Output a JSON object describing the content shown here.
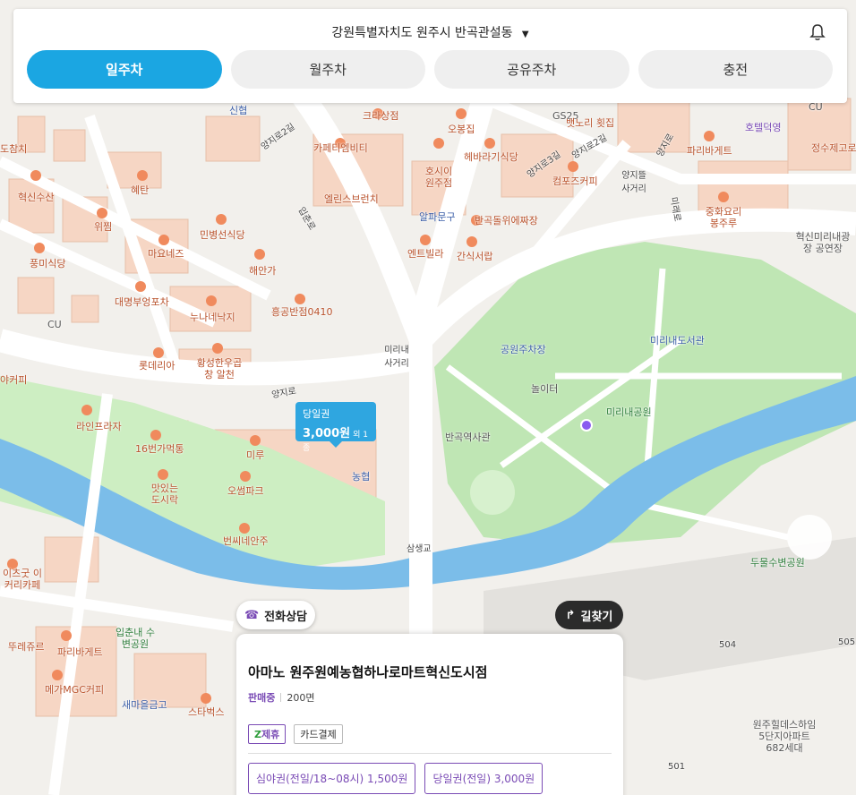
{
  "header": {
    "address": "강원특별자치도 원주시 반곡관설동",
    "tabs": [
      {
        "label": "일주차",
        "active": true
      },
      {
        "label": "월주차",
        "active": false
      },
      {
        "label": "공유주차",
        "active": false
      },
      {
        "label": "충전",
        "active": false
      }
    ]
  },
  "map": {
    "pois": [
      {
        "name": "신협"
      },
      {
        "name": "크라상점"
      },
      {
        "name": "GS25"
      },
      {
        "name": "뱃노리 횟집"
      },
      {
        "name": "CU"
      },
      {
        "name": "호텔덕영"
      },
      {
        "name": "정수제고로"
      },
      {
        "name": "오봉집"
      },
      {
        "name": "카페티엠비티"
      },
      {
        "name": "헤바라기식당"
      },
      {
        "name": "파리바게트"
      },
      {
        "name": "도참치"
      },
      {
        "name": "호시이 원주점"
      },
      {
        "name": "컴포즈커피"
      },
      {
        "name": "혜탄"
      },
      {
        "name": "혁신수산"
      },
      {
        "name": "엘린스브런치"
      },
      {
        "name": "중화요리 봉주루"
      },
      {
        "name": "위찜"
      },
      {
        "name": "알파문구"
      },
      {
        "name": "반곡돌위에짜장"
      },
      {
        "name": "혁신미리내광장 공연장"
      },
      {
        "name": "민병선식당"
      },
      {
        "name": "마요네즈"
      },
      {
        "name": "풍미식당"
      },
      {
        "name": "엔트빌라"
      },
      {
        "name": "간식서랍"
      },
      {
        "name": "해안가"
      },
      {
        "name": "대명부엉포차"
      },
      {
        "name": "누나네낙지"
      },
      {
        "name": "흥공반점0410"
      },
      {
        "name": "CU"
      },
      {
        "name": "공원주차장"
      },
      {
        "name": "미리내도서관"
      },
      {
        "name": "롯데리아"
      },
      {
        "name": "황성한우곱창 알천"
      },
      {
        "name": "놀이터"
      },
      {
        "name": "야커피"
      },
      {
        "name": "미리내공원"
      },
      {
        "name": "라인프라자"
      },
      {
        "name": "반곡역사관"
      },
      {
        "name": "16번가먹통"
      },
      {
        "name": "미루"
      },
      {
        "name": "농협"
      },
      {
        "name": "맛있는 도시락"
      },
      {
        "name": "오썸파크"
      },
      {
        "name": "번씨네안주"
      },
      {
        "name": "두물수변공원"
      },
      {
        "name": "이츠굿 이커리카페"
      },
      {
        "name": "입춘내 수변공원"
      },
      {
        "name": "뚜레쥬르"
      },
      {
        "name": "파리바게트"
      },
      {
        "name": "메가MGC커피"
      },
      {
        "name": "새마을금고"
      },
      {
        "name": "스타벅스"
      },
      {
        "name": "원주힐데스하임 5단지아파트 682세대"
      }
    ],
    "roads": [
      "양지로2길",
      "입춘로",
      "양지로3길",
      "양지로",
      "양지로2길",
      "미래로",
      "양지뜰 사거리",
      "미리내 사거리",
      "양지로",
      "삼생교"
    ],
    "building_numbers": [
      "504",
      "505",
      "501"
    ]
  },
  "price_tip": {
    "ticket": "당일권",
    "price": "3,000원",
    "extra": "외 1종"
  },
  "actions": {
    "phone": "전화상담",
    "route": "길찾기"
  },
  "card": {
    "name": "아마노 원주원예농협하나로마트혁신도시점",
    "status": "판매중",
    "unit_price": "200면",
    "badges": {
      "partner": "제휴",
      "card": "카드결제"
    },
    "tickets": [
      "심야권(전일/18~08시) 1,500원",
      "당일권(전일) 3,000원"
    ]
  },
  "colors": {
    "accent": "#1ba6e2",
    "purple": "#7a4bb5",
    "park": "#b9e3b0",
    "river": "#6fb5e8"
  }
}
